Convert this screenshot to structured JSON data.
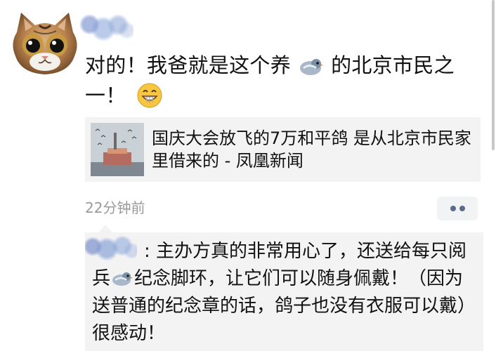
{
  "post": {
    "text_before_pigeon": "对的！我爸就是这个养",
    "text_after_pigeon": "的北京市民之一！",
    "pigeon_icon": "pigeon-icon",
    "grin_icon": "grinning-face-icon"
  },
  "link_card": {
    "title": "国庆大会放飞的7万和平鸽 是从北京市民家里借来的 - 凤凰新闻"
  },
  "meta": {
    "time": "22分钟前"
  },
  "comment": {
    "text_before_pigeon": ": 主办方真的非常用心了，还送给每只阅兵",
    "text_after_pigeon": "纪念脚环，让它们可以随身佩戴！（因为送普通的纪念章的话，鸽子也没有衣服可以戴）很感动！"
  }
}
